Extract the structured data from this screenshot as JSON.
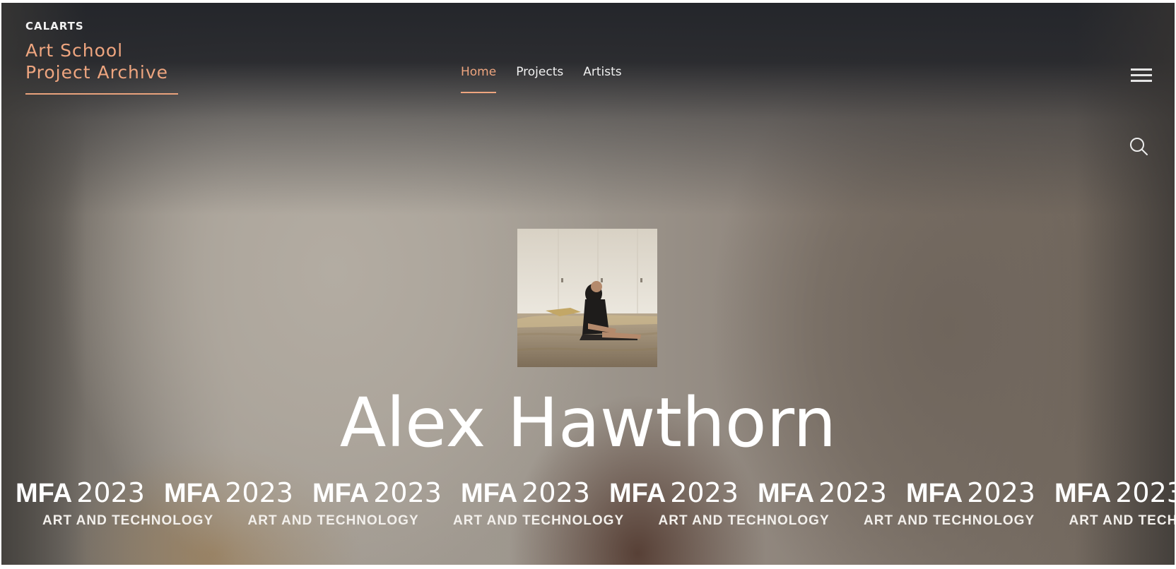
{
  "header": {
    "org_label": "CALARTS",
    "site_title_line1": "Art School",
    "site_title_line2": "Project Archive"
  },
  "nav": {
    "items": [
      {
        "label": "Home",
        "active": true
      },
      {
        "label": "Projects",
        "active": false
      },
      {
        "label": "Artists",
        "active": false
      }
    ]
  },
  "icons": {
    "menu": "hamburger-menu-icon",
    "search": "search-icon"
  },
  "hero": {
    "artist_name": "Alex Hawthorn"
  },
  "ticker": {
    "degree": "MFA",
    "year": "2023",
    "program": "ART AND TECHNOLOGY"
  },
  "colors": {
    "accent": "#eea57f",
    "header_bg": "#26282d",
    "text_light": "#ffffff"
  }
}
